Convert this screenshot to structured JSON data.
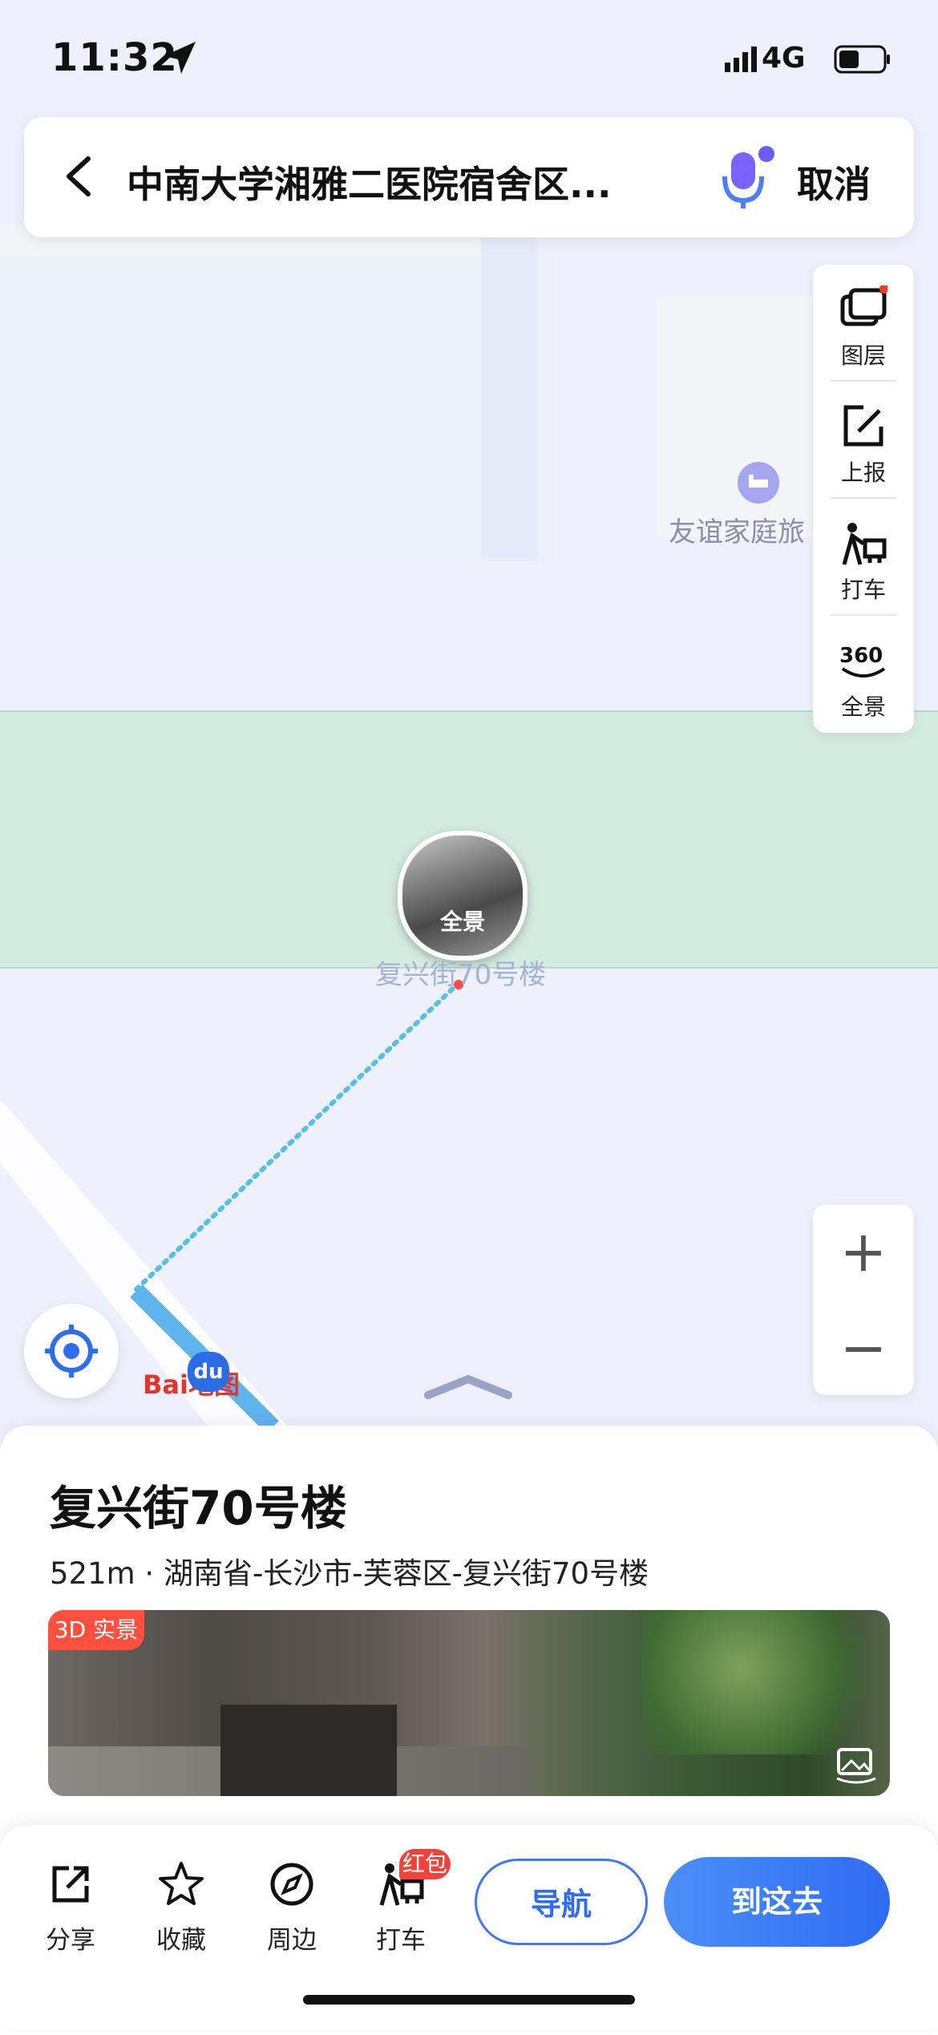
{
  "status_bar": {
    "time": "11:32",
    "carrier": "4G"
  },
  "search": {
    "query": "中南大学湘雅二医院宿舍区...",
    "cancel_label": "取消"
  },
  "tools": [
    {
      "label": "图层",
      "icon": "layers-icon"
    },
    {
      "label": "上报",
      "icon": "report-icon"
    },
    {
      "label": "打车",
      "icon": "taxi-icon"
    },
    {
      "label": "全景",
      "icon": "panorama-360-icon"
    }
  ],
  "map": {
    "poi_hotel": "友谊家庭旅",
    "poi_pano_label": "全景",
    "poi_building": "复兴街70号楼",
    "brand": "Bai地图",
    "brand_du": "du"
  },
  "place": {
    "name": "复兴街70号楼",
    "address": "521m · 湖南省-长沙市-芙蓉区-复兴街70号楼",
    "photo_badge": "3D 实景"
  },
  "actions": [
    {
      "label": "分享",
      "icon": "share-icon"
    },
    {
      "label": "收藏",
      "icon": "star-icon"
    },
    {
      "label": "周边",
      "icon": "compass-icon"
    },
    {
      "label": "打车",
      "icon": "taxi-icon"
    }
  ],
  "red_packet_badge": "红包",
  "nav_label": "导航",
  "go_label": "到这去",
  "colors": {
    "accent": "#2f6cf2",
    "badge": "#ff4f3f",
    "green_zone": "#d4ecdf"
  }
}
